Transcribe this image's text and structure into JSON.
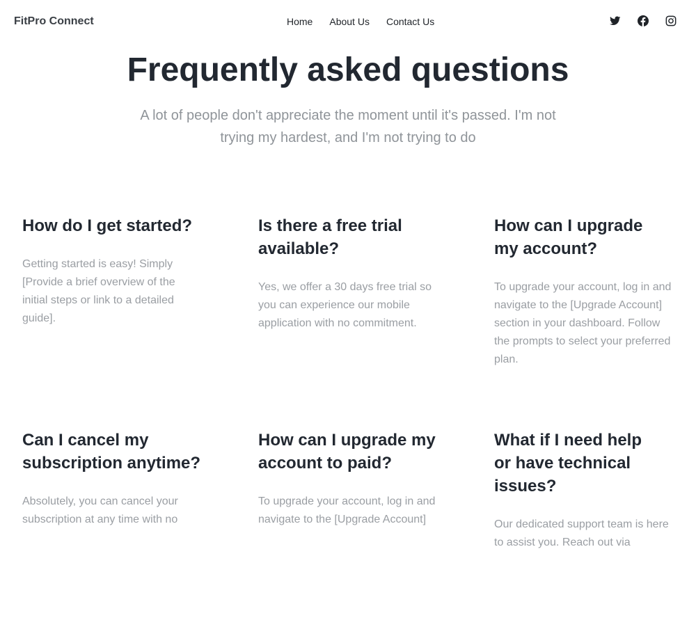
{
  "nav": {
    "brand": "FitPro Connect",
    "links": [
      "Home",
      "About Us",
      "Contact Us"
    ],
    "social_icons": [
      "twitter-icon",
      "facebook-icon",
      "instagram-icon"
    ]
  },
  "hero": {
    "title": "Frequently asked questions",
    "subtitle": "A lot of people don't appreciate the moment until it's passed. I'm not trying my hardest, and I'm not trying to do"
  },
  "faqs": [
    {
      "question": "How do I get started?",
      "answer": "Getting started is easy! Simply [Provide a brief overview of the initial steps or link to a detailed guide]."
    },
    {
      "question": "Is there a free trial available?",
      "answer": "Yes, we offer a 30 days free trial so you can experience our mobile application with no commitment."
    },
    {
      "question": "How can I upgrade my account?",
      "answer": "To upgrade your account, log in and navigate to the [Upgrade Account] section in your dashboard. Follow the prompts to select your preferred plan."
    },
    {
      "question": "Can I cancel my subscription anytime?",
      "answer": "Absolutely, you can cancel your subscription at any time with no"
    },
    {
      "question": "How can I upgrade my account to paid?",
      "answer": "To upgrade your account, log in and navigate to the [Upgrade Account]"
    },
    {
      "question": "What if I need help or have technical issues?",
      "answer": "Our dedicated support team is here to assist you. Reach out via"
    }
  ],
  "colors": {
    "heading": "#222831",
    "muted": "#9a9ea3",
    "background": "#ffffff"
  }
}
